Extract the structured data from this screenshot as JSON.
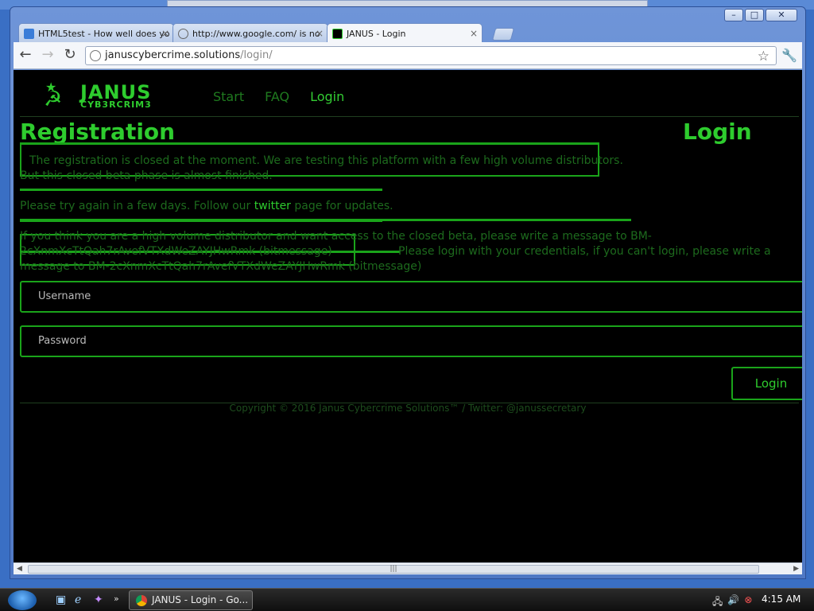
{
  "browser": {
    "tabs": [
      {
        "title": "HTML5test - How well does yo",
        "icon": "html5-icon"
      },
      {
        "title": "http://www.google.com/ is no",
        "icon": "globe-icon"
      },
      {
        "title": "JANUS - Login",
        "icon": "janus-favicon"
      }
    ],
    "url_domain": "januscybercrime.solutions",
    "url_path": "/login/"
  },
  "site": {
    "logo_word1": "JANUS",
    "logo_word2": "CYB3RCRIM3",
    "nav": [
      "Start",
      "FAQ",
      "Login"
    ],
    "active_nav": "Login"
  },
  "registration": {
    "heading": "Registration",
    "closed_line1": "The registration is closed at the moment. We are testing this platform with a few high volume distributors.",
    "closed_line2": "But this closed beta phase is almost finished.",
    "retry_pre": "Please try again in a few days. Follow our ",
    "retry_link": "twitter",
    "retry_post": " page for updates.",
    "beta_line1": "If you think you are a high volume distributor and want access to the closed beta, please write a message to BM-",
    "beta_line2": "2cXnmXcTtQah7rAvefVTXdWeZAYJHwRmk (bitmessage)",
    "login_info_line1": "Please login with your credentials, if you can't login, please write a",
    "login_info_line2": "message to BM-2cXnmXcTtQah7rAvefVTXdWeZAYJHwRmk (bitmessage)"
  },
  "login": {
    "heading": "Login",
    "username_placeholder": "Username",
    "password_placeholder": "Password",
    "button": "Login"
  },
  "footer": "Copyright © 2016 Janus Cybercrime Solutions™ / Twitter: @janussecretary",
  "taskbar": {
    "task_label": "JANUS - Login - Go...",
    "clock": "4:15 AM"
  },
  "colors": {
    "accent": "#2ecc2e",
    "dim_text": "#1d6a1d",
    "background": "#000000"
  }
}
